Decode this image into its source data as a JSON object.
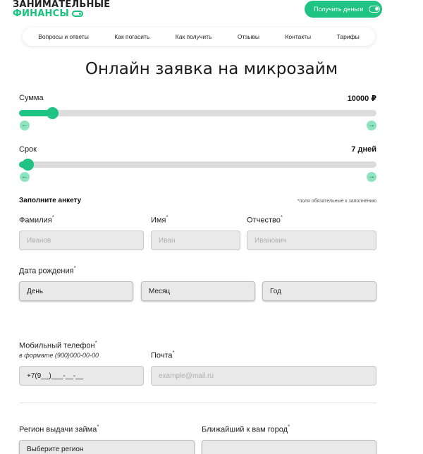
{
  "logo": {
    "line1": "ЗАНИМАТЕЛЬНЫЕ",
    "line2": "ФИНАНСЫ"
  },
  "header": {
    "cta_label": "Получить деньги"
  },
  "nav": {
    "items": [
      "Вопросы и ответы",
      "Как погасить",
      "Как получить",
      "Отзывы",
      "Контакты",
      "Тарифы"
    ]
  },
  "page": {
    "title": "Онлайн заявка на микрозайм"
  },
  "sliders": {
    "amount": {
      "label": "Сумма",
      "value": "10000 ₽",
      "fraction": 0.09
    },
    "term": {
      "label": "Срок",
      "value": "7 дней",
      "fraction": 0.02
    },
    "arrow_left": "←",
    "arrow_right": "→"
  },
  "form": {
    "section_title": "Заполните анкету",
    "required_note": "*поля обязательные к заполнению",
    "required_mark": "*",
    "last_name": {
      "label": "Фамилия",
      "placeholder": "Иванов"
    },
    "first_name": {
      "label": "Имя",
      "placeholder": "Иван"
    },
    "patronymic": {
      "label": "Отчество",
      "placeholder": "Иванович"
    },
    "birth_date": {
      "label": "Дата рождения",
      "day": "День",
      "month": "Месяц",
      "year": "Год"
    },
    "phone": {
      "label": "Мобильный телефон",
      "hint": "в формате (900)000-00-00",
      "value": "+7(9__)___-__-__"
    },
    "email": {
      "label": "Почта",
      "placeholder": "example@mail.ru"
    },
    "region": {
      "label": "Регион выдачи займа",
      "value": "Выберите регион"
    },
    "city": {
      "label": "Ближайший к вам город",
      "value": ""
    }
  },
  "colors": {
    "accent": "#1fc382",
    "input_bg": "#e9e9e9"
  }
}
